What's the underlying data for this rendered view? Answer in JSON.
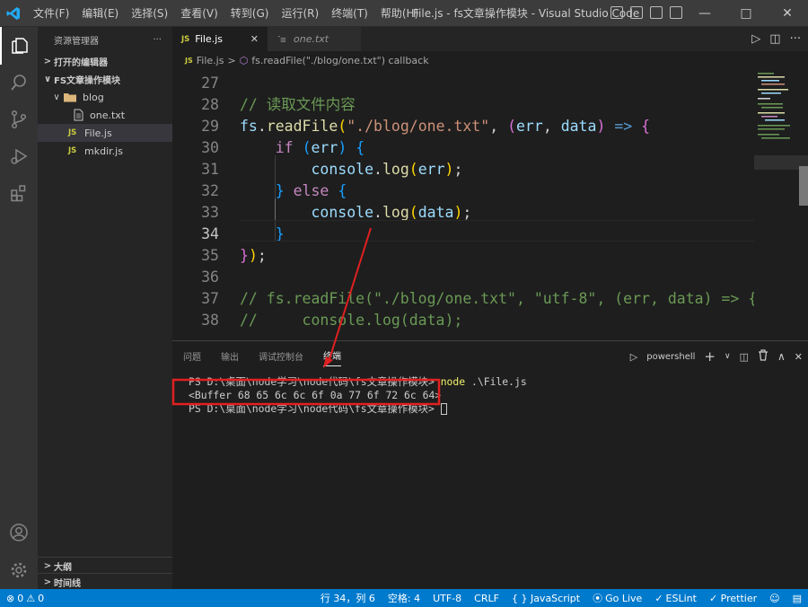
{
  "menu": [
    "文件(F)",
    "编辑(E)",
    "选择(S)",
    "查看(V)",
    "转到(G)",
    "运行(R)",
    "终端(T)",
    "帮助(H)"
  ],
  "window_title": "File.js - fs文章操作模块 - Visual Studio Code",
  "explorer": {
    "title": "资源管理器",
    "more": "···",
    "open_editors": "打开的编辑器",
    "folder": "FS文章操作模块",
    "subfolder": "blog",
    "files": [
      {
        "name": "one.txt",
        "type": "txt"
      },
      {
        "name": "File.js",
        "type": "js"
      },
      {
        "name": "mkdir.js",
        "type": "js"
      }
    ],
    "outline": "大纲",
    "timeline": "时间线"
  },
  "tabs": [
    {
      "label": "File.js",
      "icon": "JS"
    },
    {
      "label": "one.txt",
      "icon": "txt-icon"
    }
  ],
  "breadcrumb": {
    "file": "File.js",
    "sep": ">",
    "symbol": "fs.readFile(\"./blog/one.txt\") callback"
  },
  "editor": {
    "lines": [
      {
        "n": "27",
        "code": ""
      },
      {
        "n": "28",
        "code": "// 读取文件内容"
      },
      {
        "n": "29",
        "code": "fs.readFile(\"./blog/one.txt\", (err, data) => {"
      },
      {
        "n": "30",
        "code": "    if (err) {"
      },
      {
        "n": "31",
        "code": "        console.log(err);"
      },
      {
        "n": "32",
        "code": "    } else {"
      },
      {
        "n": "33",
        "code": "        console.log(data);"
      },
      {
        "n": "34",
        "code": "    }"
      },
      {
        "n": "35",
        "code": "});"
      },
      {
        "n": "36",
        "code": ""
      },
      {
        "n": "37",
        "code": "// fs.readFile(\"./blog/one.txt\", \"utf-8\", (err, data) => {"
      },
      {
        "n": "38",
        "code": "//     console.log(data);"
      }
    ]
  },
  "panel": {
    "tabs": [
      "问题",
      "输出",
      "调试控制台",
      "终端"
    ],
    "shell": "powershell",
    "terminal": {
      "prompt1": "PS D:\\桌面\\node学习\\node代码\\fs文章操作模块> ",
      "cmd": "node",
      "arg": " .\\File.js",
      "output": "<Buffer 68 65 6c 6c 6f 0a 77 6f 72 6c 64>",
      "prompt2": "PS D:\\桌面\\node学习\\node代码\\fs文章操作模块> "
    }
  },
  "statusbar": {
    "errors": "0",
    "warnings": "0",
    "position": "行 34，列 6",
    "spaces": "空格: 4",
    "encoding": "UTF-8",
    "eol": "CRLF",
    "language": "{ } JavaScript",
    "golive": "Go Live",
    "eslint": "ESLint",
    "prettier": "✓ Prettier"
  },
  "colors": {
    "statusbar": "#007acc",
    "annotation": "#e02020"
  }
}
